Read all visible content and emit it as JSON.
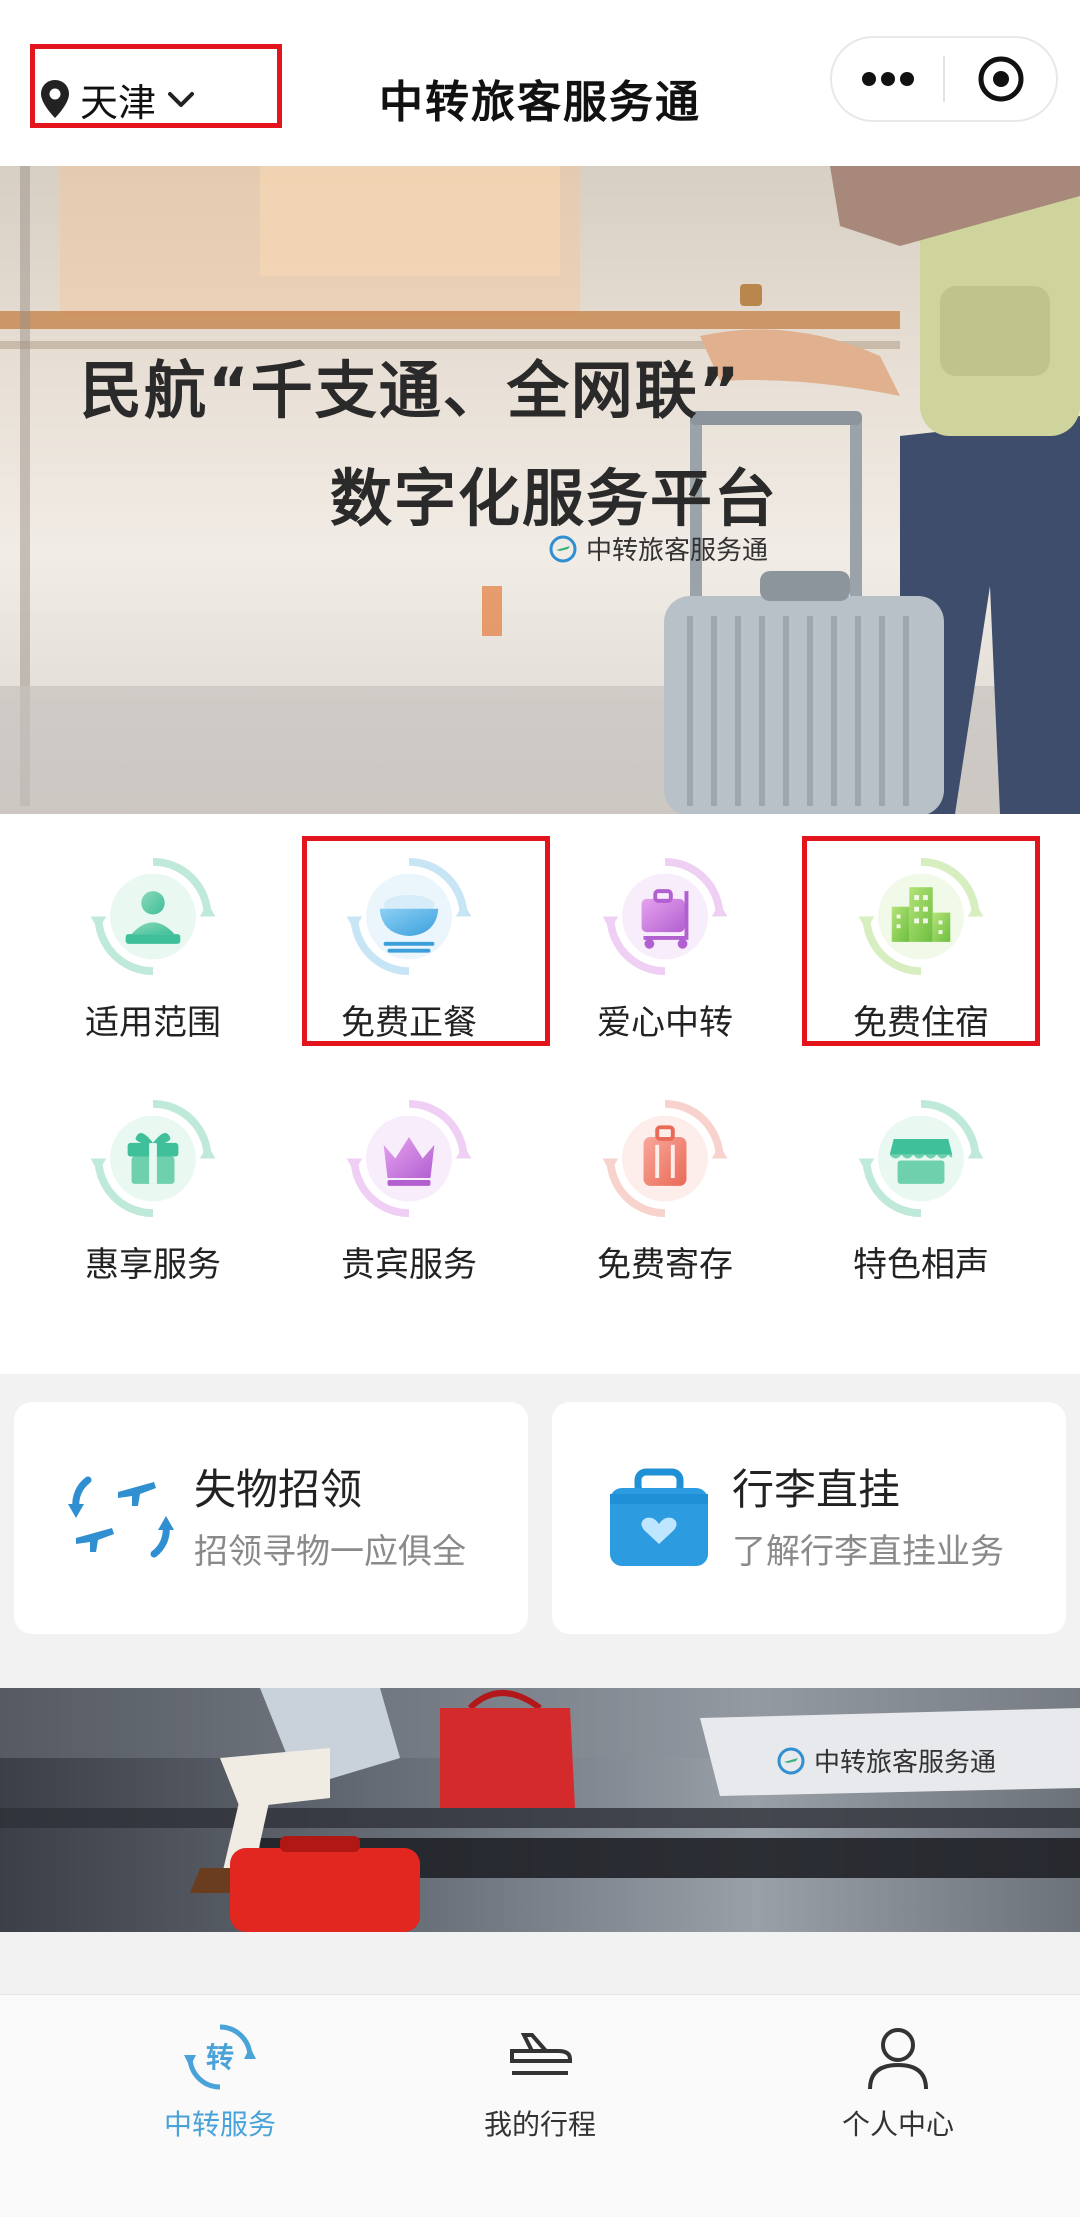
{
  "nav": {
    "city": "天津",
    "title": "中转旅客服务通"
  },
  "hero": {
    "line1": "民航“千支通、全网联”",
    "line2": "数字化服务平台",
    "brand": "中转旅客服务通"
  },
  "services": [
    {
      "label": "适用范围",
      "icon": "person-desk-icon"
    },
    {
      "label": "免费正餐",
      "icon": "rice-bowl-icon"
    },
    {
      "label": "爱心中转",
      "icon": "luggage-cart-icon"
    },
    {
      "label": "免费住宿",
      "icon": "hotel-building-icon"
    },
    {
      "label": "惠享服务",
      "icon": "gift-icon"
    },
    {
      "label": "贵宾服务",
      "icon": "crown-icon"
    },
    {
      "label": "免费寄存",
      "icon": "suitcase-icon"
    },
    {
      "label": "特色相声",
      "icon": "shop-icon"
    }
  ],
  "cards": [
    {
      "title": "失物招领",
      "subtitle": "招领寻物一应俱全",
      "icon": "airplanes-arrows-icon"
    },
    {
      "title": "行李直挂",
      "subtitle": "了解行李直挂业务",
      "icon": "luggage-heart-icon"
    }
  ],
  "banner2": {
    "brand": "中转旅客服务通"
  },
  "tabs": [
    {
      "label": "中转服务",
      "icon": "transfer-icon",
      "active": true
    },
    {
      "label": "我的行程",
      "icon": "landing-plane-icon",
      "active": false
    },
    {
      "label": "个人中心",
      "icon": "user-icon",
      "active": false
    }
  ],
  "colors": {
    "highlight": "#e3141b",
    "active_tab": "#4aa3d8",
    "icon_ring_teal": "#48c39e",
    "icon_ring_blue": "#49a9e0"
  }
}
